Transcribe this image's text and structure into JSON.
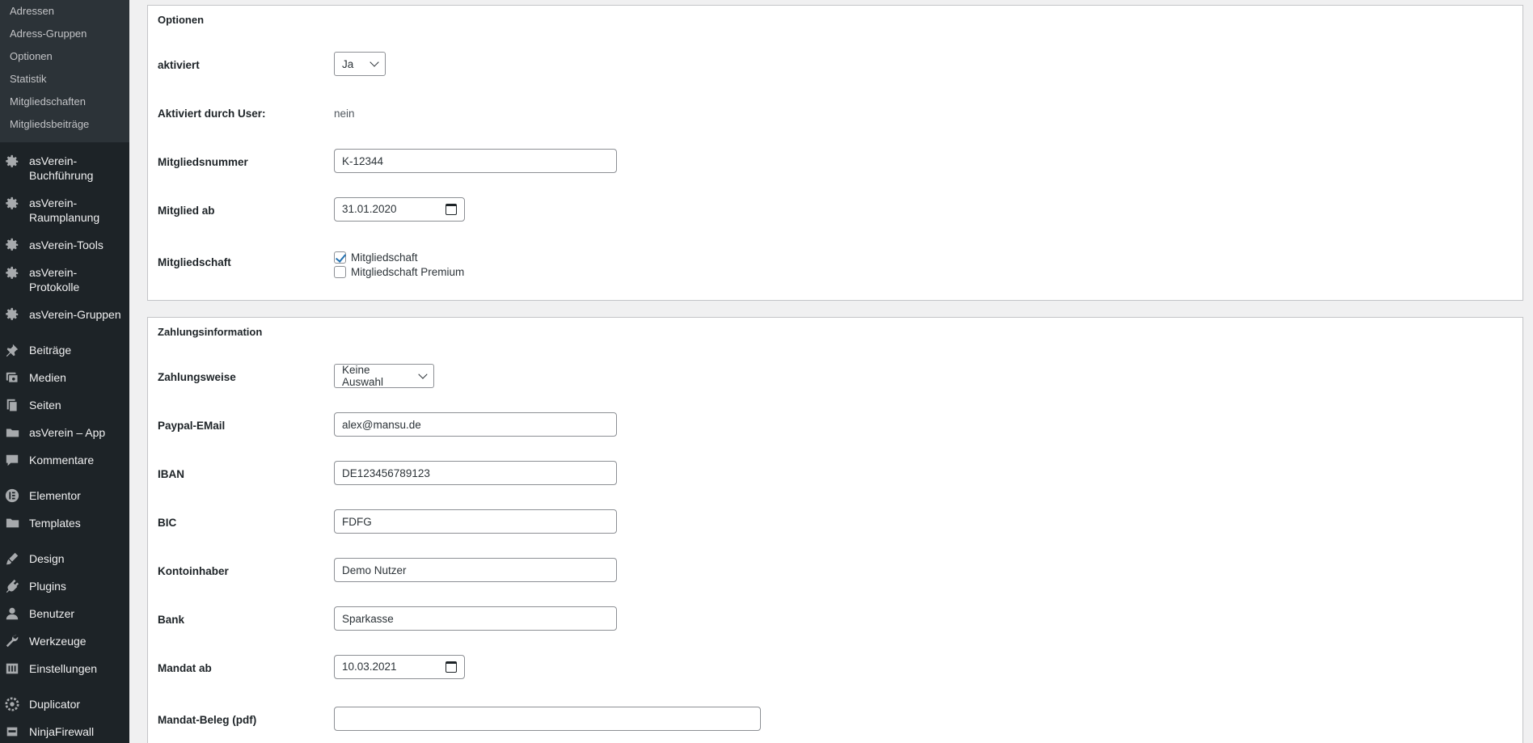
{
  "sidebar": {
    "submenu": [
      "Adressen",
      "Adress-Gruppen",
      "Optionen",
      "Statistik",
      "Mitgliedschaften",
      "Mitgliedsbeiträge"
    ],
    "menu": [
      {
        "label": "asVerein-Buchführung",
        "line1": "asVerein-",
        "line2": "Buchführung",
        "icon": "gear-icon"
      },
      {
        "label": "asVerein-Raumplanung",
        "line1": "asVerein-",
        "line2": "Raumplanung",
        "icon": "gear-icon"
      },
      {
        "label": "asVerein-Tools",
        "icon": "gear-icon"
      },
      {
        "label": "asVerein-Protokolle",
        "line1": "asVerein-",
        "line2": "Protokolle",
        "icon": "gear-icon"
      },
      {
        "label": "asVerein-Gruppen",
        "icon": "gear-icon"
      },
      {
        "label": "Beiträge",
        "icon": "pin-icon"
      },
      {
        "label": "Medien",
        "icon": "media-icon"
      },
      {
        "label": "Seiten",
        "icon": "pages-icon"
      },
      {
        "label": "asVerein – App",
        "icon": "folder-icon"
      },
      {
        "label": "Kommentare",
        "icon": "comment-icon"
      },
      {
        "label": "Elementor",
        "icon": "elementor-icon"
      },
      {
        "label": "Templates",
        "icon": "folder-icon"
      },
      {
        "label": "Design",
        "icon": "brush-icon"
      },
      {
        "label": "Plugins",
        "icon": "plugin-icon"
      },
      {
        "label": "Benutzer",
        "icon": "user-icon"
      },
      {
        "label": "Werkzeuge",
        "icon": "wrench-icon"
      },
      {
        "label": "Einstellungen",
        "icon": "settings-icon"
      },
      {
        "label": "Duplicator",
        "icon": "duplicator-icon"
      },
      {
        "label": "NinjaFirewall",
        "icon": "ninja-icon"
      }
    ]
  },
  "optionen": {
    "title": "Optionen",
    "aktiviert": {
      "label": "aktiviert",
      "value": "Ja"
    },
    "aktiviert_user": {
      "label": "Aktiviert durch User:",
      "value": "nein"
    },
    "mitgliedsnummer": {
      "label": "Mitgliedsnummer",
      "value": "K-12344"
    },
    "mitglied_ab": {
      "label": "Mitglied ab",
      "value": "31.01.2020"
    },
    "mitgliedschaft": {
      "label": "Mitgliedschaft",
      "options": [
        {
          "label": "Mitgliedschaft",
          "checked": true
        },
        {
          "label": "Mitgliedschaft Premium",
          "checked": false
        }
      ]
    }
  },
  "zahlung": {
    "title": "Zahlungsinformation",
    "zahlungsweise": {
      "label": "Zahlungsweise",
      "value": "Keine Auswahl"
    },
    "paypal": {
      "label": "Paypal-EMail",
      "value": "alex@mansu.de"
    },
    "iban": {
      "label": "IBAN",
      "value": "DE123456789123"
    },
    "bic": {
      "label": "BIC",
      "value": "FDFG"
    },
    "kontoinhaber": {
      "label": "Kontoinhaber",
      "value": "Demo Nutzer"
    },
    "bank": {
      "label": "Bank",
      "value": "Sparkasse"
    },
    "mandat_ab": {
      "label": "Mandat ab",
      "value": "10.03.2021"
    },
    "mandat_beleg": {
      "label": "Mandat-Beleg (pdf)",
      "value": ""
    }
  }
}
